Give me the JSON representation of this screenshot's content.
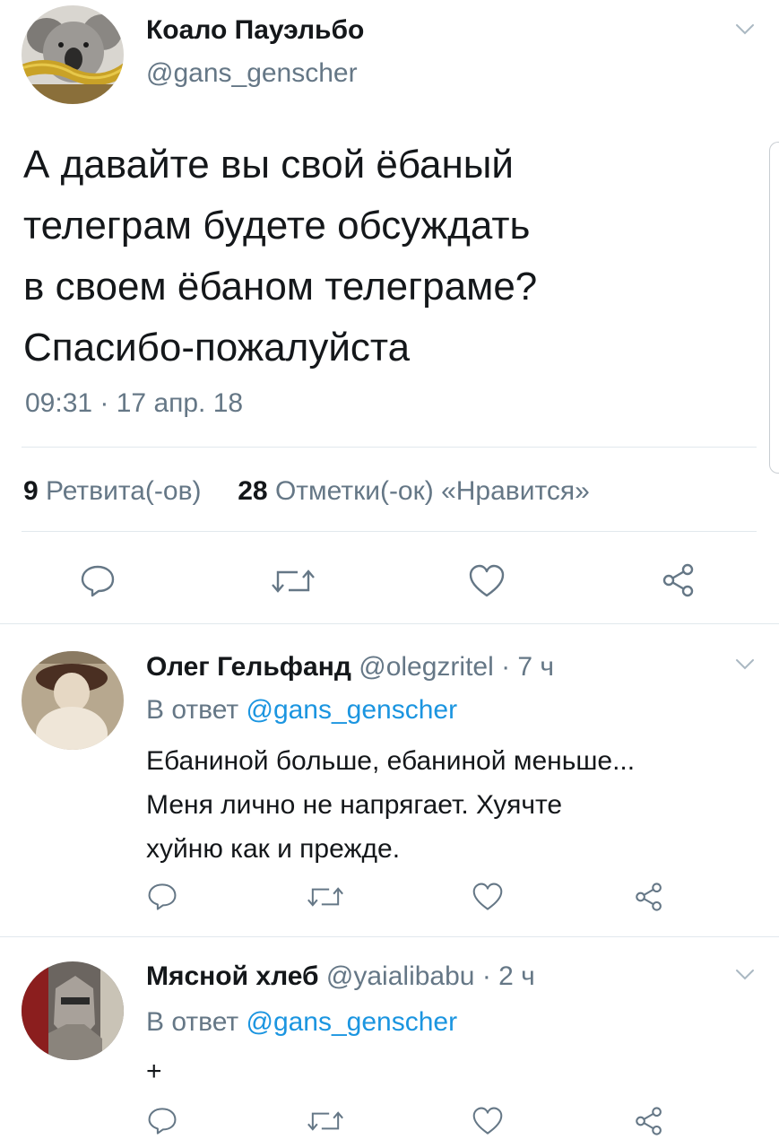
{
  "main_tweet": {
    "display_name": "Коало Пауэльбо",
    "handle": "@gans_genscher",
    "text_lines": [
      "А давайте вы свой ёбаный",
      "телеграм будете обсуждать",
      "в своем ёбаном телеграме?",
      "Спасибо-пожалуйста"
    ],
    "timestamp": "09:31 · 17 апр. 18",
    "retweet_count": "9",
    "retweet_label": "Ретвита(-ов)",
    "like_count": "28",
    "like_label": "Отметки(-ок) «Нравится»"
  },
  "replies": [
    {
      "display_name": "Олег Гельфанд",
      "handle_time": "@olegzritel · 7 ч",
      "reply_to_prefix": "В ответ",
      "reply_to_handle": "@gans_genscher",
      "text_lines": [
        "Ебаниной больше, ебаниной меньше...",
        "Меня лично не напрягает. Хуячте",
        "хуйню как и прежде."
      ]
    },
    {
      "display_name": "Мясной хлеб",
      "handle_time": "@yaialibabu · 2 ч",
      "reply_to_prefix": "В ответ",
      "reply_to_handle": "@gans_genscher",
      "text_lines": [
        "+"
      ]
    }
  ],
  "colors": {
    "text": "#14171a",
    "secondary": "#657786",
    "link": "#1b95e0",
    "divider": "#e1e8ed"
  },
  "icons": [
    "chevron-down-icon",
    "reply-icon",
    "retweet-icon",
    "like-icon",
    "share-icon"
  ]
}
